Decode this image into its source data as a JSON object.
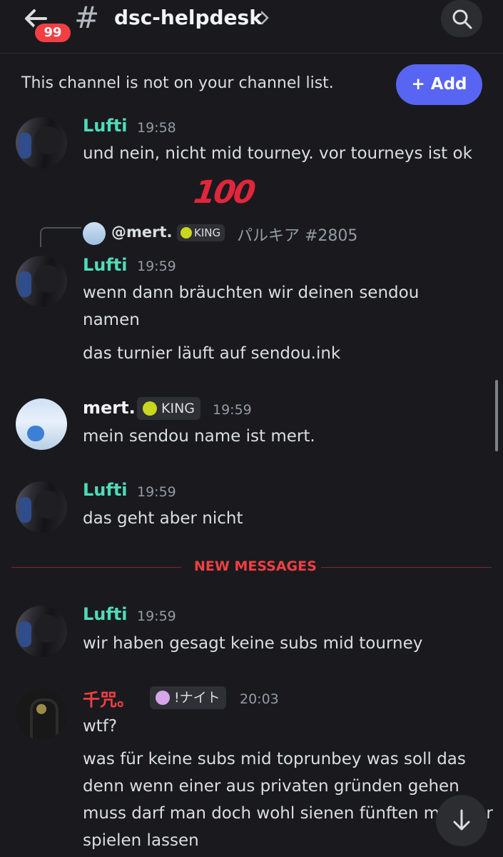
{
  "header": {
    "channel_name": "dsc-helpdesk",
    "badge_count": "99",
    "hash": "#"
  },
  "notice": {
    "text": "This channel is not on your channel list.",
    "add_label": "+ Add"
  },
  "reply": {
    "name": "@mert.",
    "role": "KING",
    "text": "パルキア #2805"
  },
  "reaction": {
    "emoji": "100"
  },
  "divider": {
    "label": "NEW MESSAGES"
  },
  "messages": [
    {
      "author": "Lufti",
      "time": "19:58",
      "lines": [
        "und nein, nicht mid tourney. vor tourneys ist ok"
      ]
    },
    {
      "author": "Lufti",
      "time": "19:59",
      "lines": [
        "wenn dann bräuchten wir deinen sendou namen",
        "das turnier läuft auf sendou.ink"
      ]
    },
    {
      "author": "mert.",
      "role": "KING",
      "time": "19:59",
      "lines": [
        "mein sendou name ist mert."
      ]
    },
    {
      "author": "Lufti",
      "time": "19:59",
      "lines": [
        "das geht aber nicht"
      ]
    },
    {
      "author": "Lufti",
      "time": "19:59",
      "lines": [
        "wir haben gesagt keine subs mid tourney"
      ]
    },
    {
      "author": "千咒。",
      "role": "!ナイト",
      "time": "20:03",
      "lines": [
        "wtf?",
        "was für keine subs mid toprunbey was soll das denn wenn einer aus privaten gründen gehen muss darf man doch wohl sienen fünften member spielen lassen"
      ]
    }
  ],
  "colors": {
    "lufti": "#4fdbb9",
    "senpu": "#f23f43",
    "mert": "#f2f3f5",
    "king_dot": "#c8d61e",
    "knight_dot": "#d7a6e8",
    "accent": "#5865f2"
  }
}
